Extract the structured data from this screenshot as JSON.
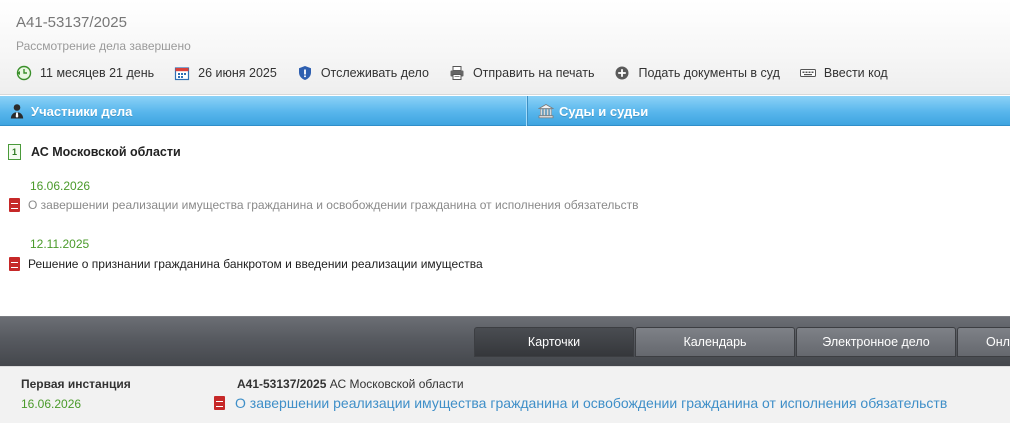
{
  "case": {
    "number": "А41-53137/2025",
    "status": "Рассмотрение дела завершено"
  },
  "toolbar": [
    {
      "name": "duration",
      "label": "11 месяцев 21 день",
      "icon": "clock-icon"
    },
    {
      "name": "date",
      "label": "26 июня 2025",
      "icon": "calendar-icon"
    },
    {
      "name": "track",
      "label": "Отслеживать дело",
      "icon": "shield-icon"
    },
    {
      "name": "print",
      "label": "Отправить на печать",
      "icon": "printer-icon"
    },
    {
      "name": "submit",
      "label": "Подать документы в суд",
      "icon": "plus-circle-icon"
    },
    {
      "name": "code",
      "label": "Ввести код",
      "icon": "keyboard-icon"
    }
  ],
  "tabs": {
    "participants": "Участники дела",
    "courts": "Суды и судьи"
  },
  "court": {
    "badge": "1",
    "name": "АС Московской области"
  },
  "documents": [
    {
      "date": "16.06.2026",
      "title": "О завершении реализации имущества гражданина и освобождении гражданина от исполнения обязательств"
    },
    {
      "date": "12.11.2025",
      "title": "Решение о признании гражданина банкротом и введении реализации имущества"
    }
  ],
  "view_tabs": [
    "Карточки",
    "Календарь",
    "Электронное дело",
    "Онла"
  ],
  "instance": {
    "label": "Первая инстанция",
    "date": "16.06.2026",
    "case_number": "А41-53137/2025",
    "court": "АС Московской области",
    "doc_title": "О завершении реализации имущества гражданина и освобождении гражданина от исполнения обязательств"
  },
  "colors": {
    "accent_blue": "#58b6ec",
    "date_green": "#4a9a2a",
    "pdf_red": "#c62828",
    "link_blue": "#3f8fc8"
  }
}
